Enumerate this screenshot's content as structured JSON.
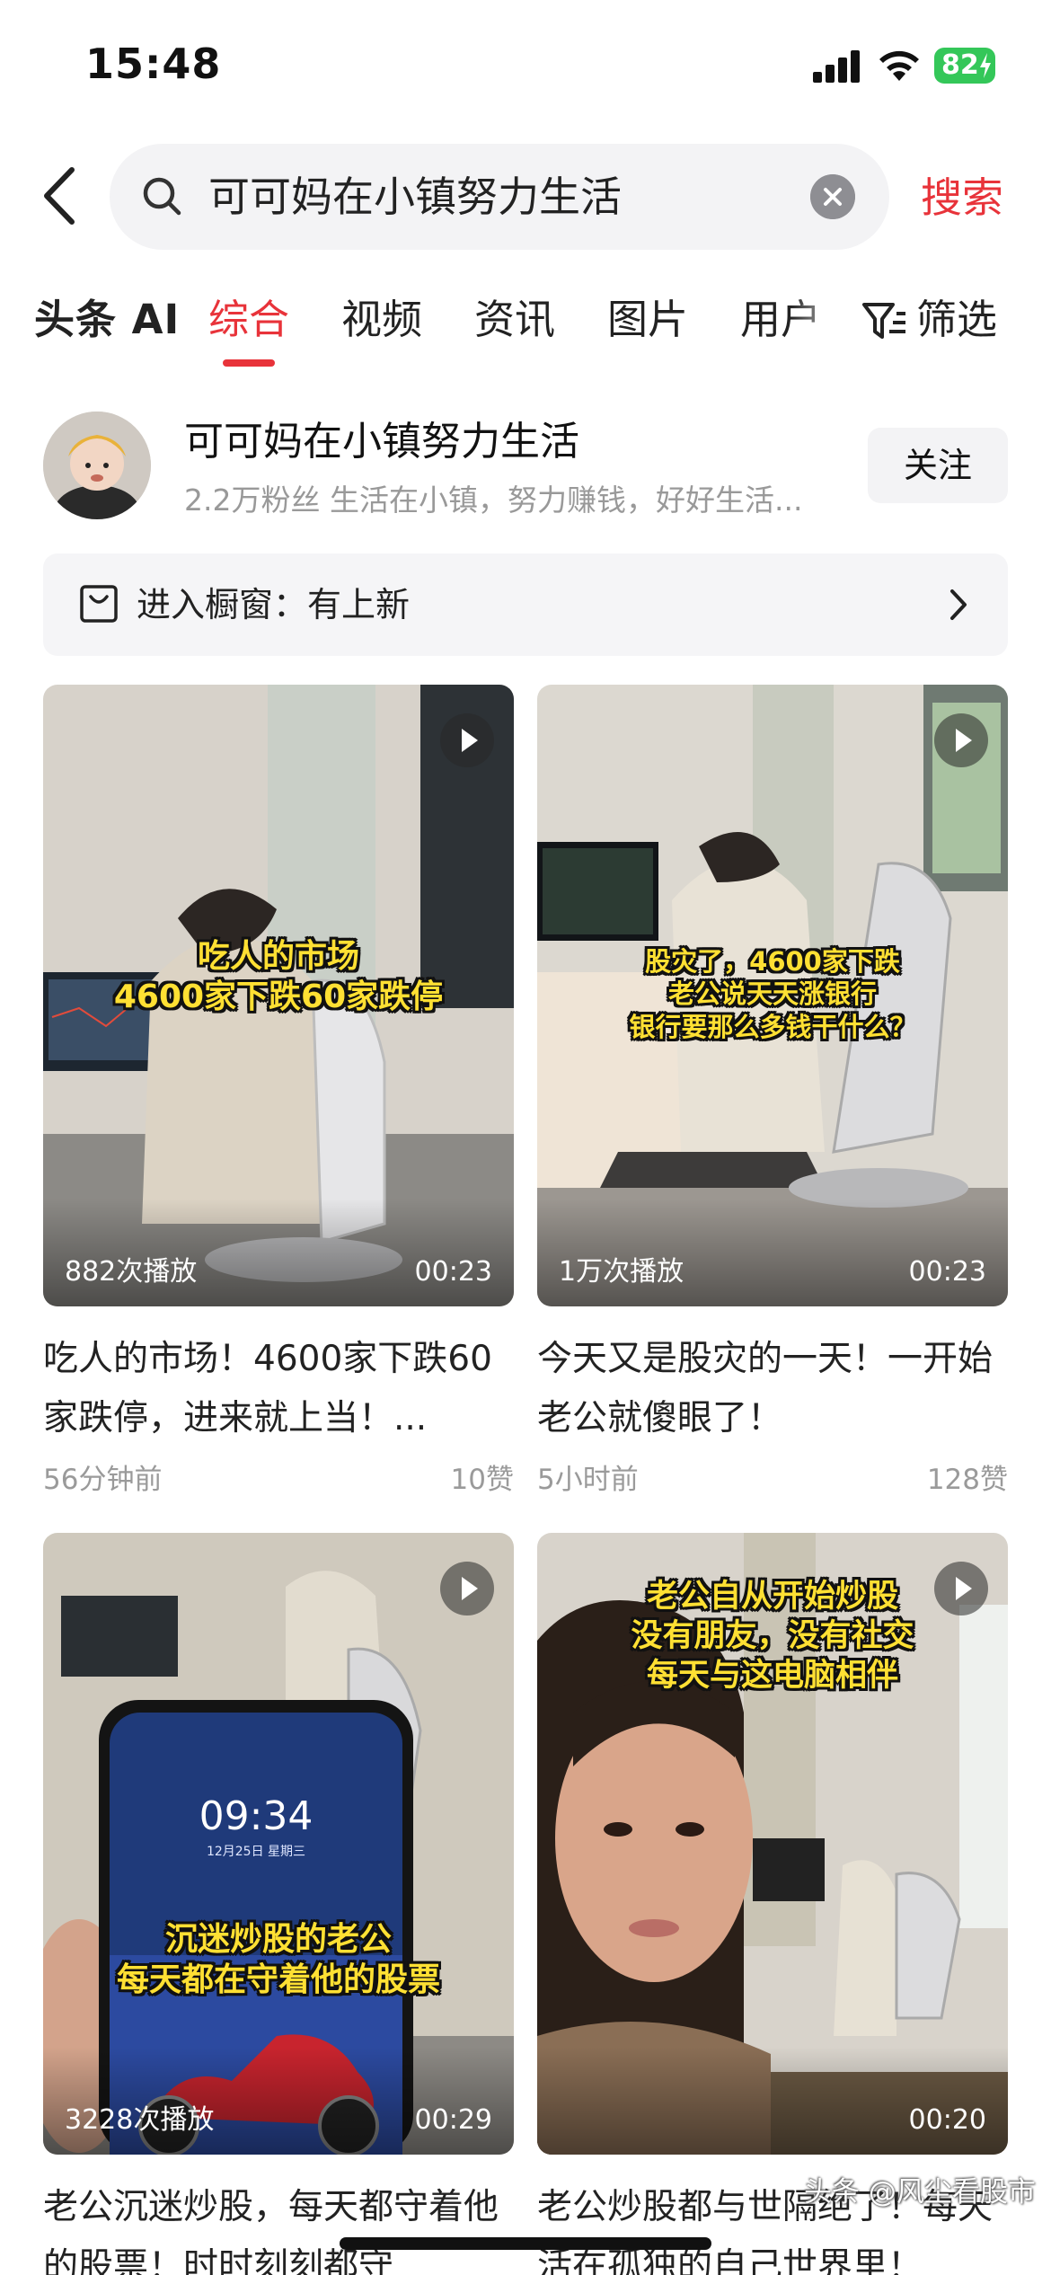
{
  "status_bar": {
    "time": "15:48",
    "battery": "82"
  },
  "search": {
    "query": "可可妈在小镇努力生活",
    "submit_label": "搜索"
  },
  "tabs": [
    {
      "label": "头条 AI"
    },
    {
      "label": "综合",
      "active": true
    },
    {
      "label": "视频"
    },
    {
      "label": "资讯"
    },
    {
      "label": "图片"
    },
    {
      "label": "用户"
    }
  ],
  "filter_label": "筛选",
  "account": {
    "name": "可可妈在小镇努力生活",
    "description": "2.2万粉丝  生活在小镇，努力赚钱，好好生活...",
    "follow_label": "关注"
  },
  "shop_bar": {
    "text": "进入橱窗：有上新"
  },
  "videos": [
    {
      "caption_lines": [
        "吃人的市场",
        "4600家下跌60家跌停"
      ],
      "plays": "882次播放",
      "duration": "00:23",
      "title": "吃人的市场！4600家下跌60家跌停，进来就上当！...",
      "time": "56分钟前",
      "likes": "10赞"
    },
    {
      "caption_lines": [
        "股灾了，4600家下跌",
        "老公说天天涨银行",
        "银行要那么多钱干什么？"
      ],
      "plays": "1万次播放",
      "duration": "00:23",
      "title": "今天又是股灾的一天！一开始老公就傻眼了！",
      "time": "5小时前",
      "likes": "128赞"
    },
    {
      "caption_lines": [
        "沉迷炒股的老公",
        "每天都在守着他的股票"
      ],
      "phone_time": "09:34",
      "phone_date": "12月25日 星期三",
      "plays": "3228次播放",
      "duration": "00:29",
      "title": "老公沉迷炒股，每天都守着他的股票！时时刻刻都守"
    },
    {
      "caption_lines": [
        "老公自从开始炒股",
        "没有朋友，没有社交",
        "每天与这电脑相伴"
      ],
      "plays": "",
      "duration": "00:20",
      "title": "老公炒股都与世隔绝了！每天活在孤独的自己世界里！"
    }
  ],
  "watermark": "头条 @风尘看股市",
  "colors": {
    "accent": "#e8333a",
    "caption_yellow": "#ffe033"
  }
}
